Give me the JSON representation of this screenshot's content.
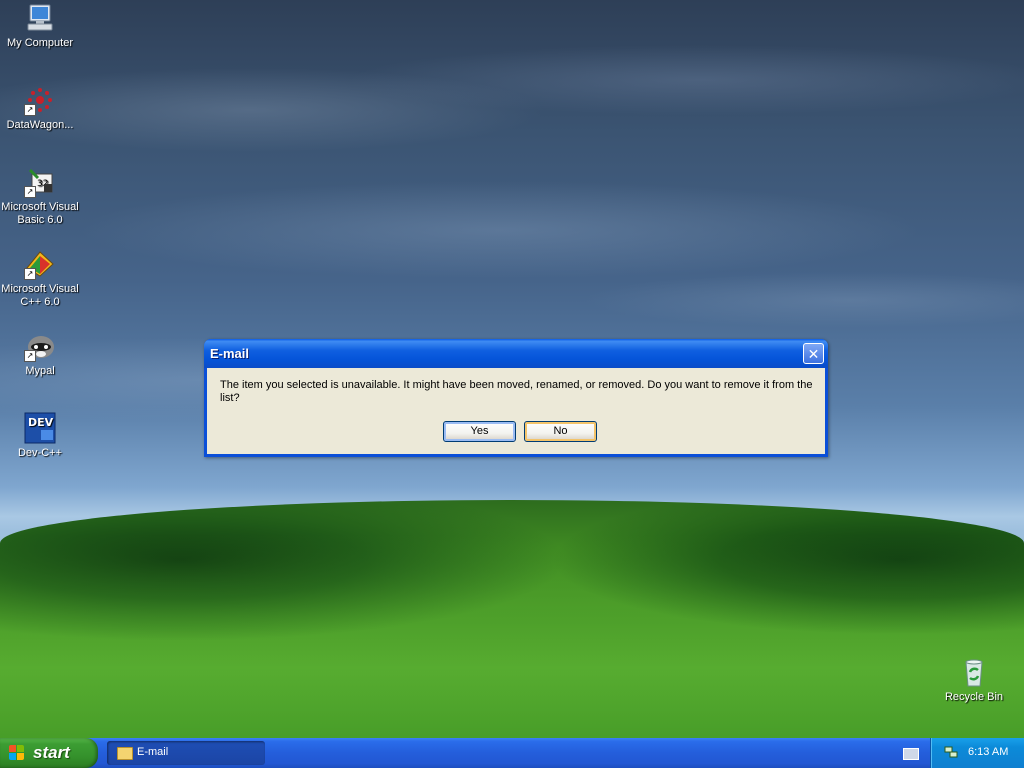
{
  "desktop": {
    "icons": [
      {
        "label": "My Computer",
        "icon": "computer-icon"
      },
      {
        "label": "DataWagon...",
        "icon": "datawagon-icon"
      },
      {
        "label": "Microsoft Visual Basic 6.0",
        "icon": "visual-basic-icon"
      },
      {
        "label": "Microsoft Visual C++ 6.0",
        "icon": "visual-cpp-icon"
      },
      {
        "label": "Mypal",
        "icon": "mypal-icon"
      },
      {
        "label": "Dev-C++",
        "icon": "devcpp-icon",
        "badge": "DEV"
      },
      {
        "label": "Recycle Bin",
        "icon": "recycle-bin-icon"
      }
    ]
  },
  "dialog": {
    "title": "E-mail",
    "close_symbol": "✕",
    "message": "The item you selected is unavailable.  It might have been moved, renamed, or removed.  Do you want to remove it from the list?",
    "yes_label": "Yes",
    "no_label": "No"
  },
  "taskbar": {
    "start_label": "start",
    "task_item_label": "E-mail",
    "clock": "6:13 AM"
  },
  "colors": {
    "title_bar": "#0554d9",
    "dialog_face": "#ece9d8",
    "taskbar": "#245edb",
    "start_button": "#3c9d33",
    "tray": "#0c8bd9"
  }
}
